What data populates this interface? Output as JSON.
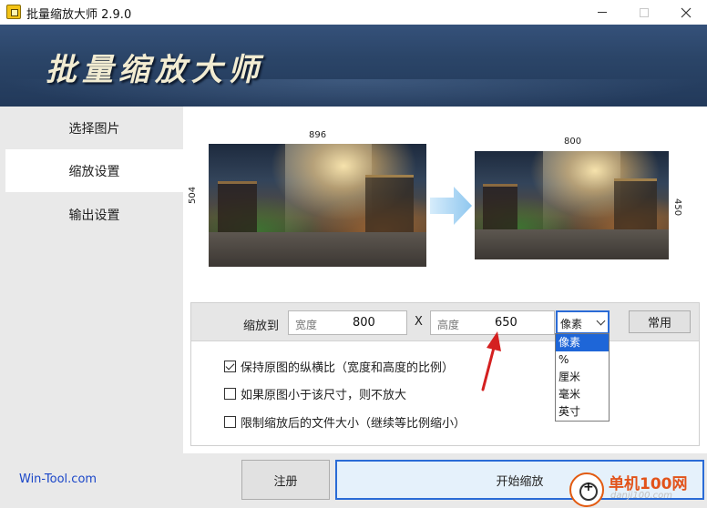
{
  "window": {
    "title": "批量缩放大师 2.9.0",
    "icon": "app-logo-icon"
  },
  "banner": {
    "title": "批量缩放大师"
  },
  "sidebar": {
    "items": [
      {
        "label": "选择图片",
        "active": false
      },
      {
        "label": "缩放设置",
        "active": true
      },
      {
        "label": "输出设置",
        "active": false
      }
    ],
    "site_link": "Win-Tool.com"
  },
  "preview": {
    "before": {
      "width": "896",
      "height": "504"
    },
    "after": {
      "width": "800",
      "height": "450"
    },
    "arrow_icon": "right-arrow-icon"
  },
  "resize": {
    "label": "缩放到",
    "width_placeholder": "宽度",
    "width_value": "800",
    "separator": "X",
    "height_placeholder": "高度",
    "height_value": "650",
    "unit_selected": "像素",
    "common_button": "常用",
    "unit_options": [
      "像素",
      "%",
      "厘米",
      "毫米",
      "英寸"
    ]
  },
  "options": [
    {
      "label": "保持原图的纵横比（宽度和高度的比例）",
      "checked": true
    },
    {
      "label": "如果原图小于该尺寸，则不放大",
      "checked": false
    },
    {
      "label": "限制缩放后的文件大小（继续等比例缩小）",
      "checked": false
    }
  ],
  "actions": {
    "register": "注册",
    "start": "开始缩放"
  },
  "watermark": {
    "text": "单机100网",
    "sub": "danji100.com"
  },
  "colors": {
    "accent": "#2a6bd6",
    "selection": "#1e66d8",
    "banner": "#2b4568",
    "annotation_arrow": "#d42020"
  }
}
